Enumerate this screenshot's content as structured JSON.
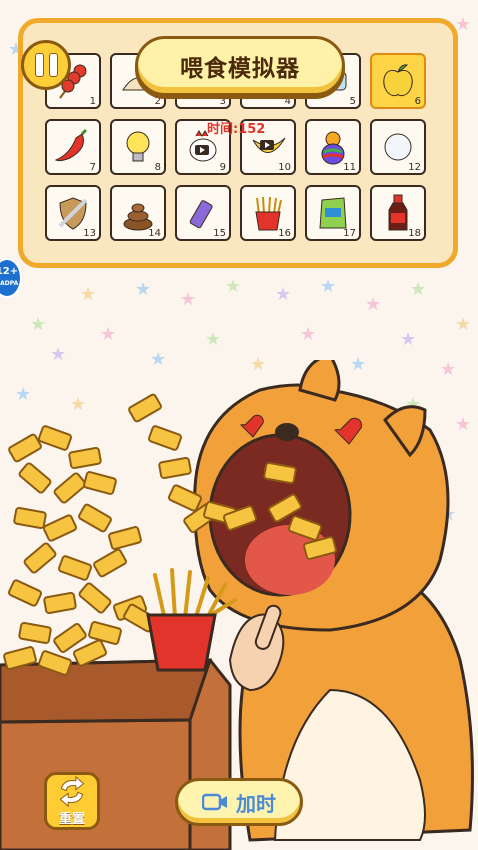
{
  "game": {
    "title": "喂食模拟器",
    "timer": "时间:152"
  },
  "badge": {
    "age": "12+",
    "sub": "CADPA"
  },
  "items": [
    {
      "num": "1",
      "icon": "tanghulu-icon"
    },
    {
      "num": "2",
      "icon": "dumpling-icon"
    },
    {
      "num": "3",
      "icon": "food-icon"
    },
    {
      "num": "4",
      "icon": "food-icon"
    },
    {
      "num": "5",
      "icon": "food-icon"
    },
    {
      "num": "6",
      "icon": "golden-apple-icon"
    },
    {
      "num": "7",
      "icon": "chili-pepper-icon"
    },
    {
      "num": "8",
      "icon": "light-bulb-icon"
    },
    {
      "num": "9",
      "icon": "rooster-video-icon"
    },
    {
      "num": "10",
      "icon": "banana-video-icon"
    },
    {
      "num": "11",
      "icon": "rainbow-gourd-icon"
    },
    {
      "num": "12",
      "icon": "snowball-icon"
    },
    {
      "num": "13",
      "icon": "sword-shield-icon"
    },
    {
      "num": "14",
      "icon": "poop-icon"
    },
    {
      "num": "15",
      "icon": "glue-stick-icon"
    },
    {
      "num": "16",
      "icon": "french-fries-icon"
    },
    {
      "num": "17",
      "icon": "chips-bag-icon"
    },
    {
      "num": "18",
      "icon": "vinegar-bottle-icon"
    }
  ],
  "controls": {
    "reset_label": "重置",
    "add_time_label": "加时"
  },
  "colors": {
    "panel_border": "#f0a92a",
    "panel_bg": "#fbe7bf",
    "gold": "#ffcf3a",
    "timer_red": "#e2342b"
  }
}
